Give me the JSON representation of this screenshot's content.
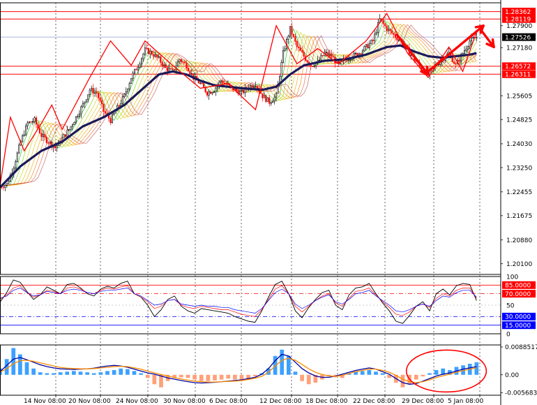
{
  "colors": {
    "background": "#ffffff",
    "bull": "#000000",
    "bear": "#ff0000",
    "level_line": "#ff0000",
    "current_price_line": "#aab4e6",
    "current_price_tag": "#000000",
    "slow_ma": "#1a1a5a",
    "zigzag": "#ff0000",
    "stoch_main": "#000000",
    "stoch_signal": "#ff0000",
    "stoch_third": "#0000ff",
    "macd_pos": "#3ca0ff",
    "macd_neg": "#ffa07a",
    "macd_line": "#0000a0",
    "macd_signal": "#ff8c00",
    "highlight_circle": "#ff0000"
  },
  "chart_data": [
    {
      "type": "candlestick",
      "panel": "main",
      "y_ticks": [
        "1.28362",
        "1.28119",
        "1.27900",
        "1.27526",
        "1.27180",
        "1.26572",
        "1.26311",
        "1.25605",
        "1.24825",
        "1.24030",
        "1.23250",
        "1.22455",
        "1.21675",
        "1.20880",
        "1.20100"
      ],
      "ylim": [
        1.1975,
        1.2865
      ],
      "grid": false,
      "x_ticks": [
        "14 Nov 08:00",
        "20 Nov 08:00",
        "24 Nov 08:00",
        "30 Nov 08:00",
        "6 Dec 08:00",
        "12 Dec 08:00",
        "18 Dec 08:00",
        "22 Dec 08:00",
        "29 Dec 08:00",
        "5 Jan 08:00"
      ],
      "horizontal_levels": [
        1.28362,
        1.28119,
        1.26572,
        1.26311
      ],
      "current_price": 1.27526,
      "price_tags": [
        {
          "value": 1.28362,
          "label": "1.28362",
          "style": "level"
        },
        {
          "value": 1.28119,
          "label": "1.28119",
          "style": "level"
        },
        {
          "value": 1.27526,
          "label": "1.27526",
          "style": "current"
        },
        {
          "value": 1.26572,
          "label": "1.26572",
          "style": "level"
        },
        {
          "value": 1.26311,
          "label": "1.26311",
          "style": "level"
        }
      ],
      "close_path": [
        [
          0,
          1.2265
        ],
        [
          4,
          1.227
        ],
        [
          8,
          1.233
        ],
        [
          12,
          1.241
        ],
        [
          16,
          1.247
        ],
        [
          20,
          1.248
        ],
        [
          24,
          1.243
        ],
        [
          28,
          1.241
        ],
        [
          32,
          1.239
        ],
        [
          36,
          1.242
        ],
        [
          40,
          1.245
        ],
        [
          44,
          1.249
        ],
        [
          48,
          1.253
        ],
        [
          52,
          1.258
        ],
        [
          56,
          1.257
        ],
        [
          60,
          1.251
        ],
        [
          64,
          1.248
        ],
        [
          68,
          1.252
        ],
        [
          72,
          1.256
        ],
        [
          76,
          1.262
        ],
        [
          80,
          1.266
        ],
        [
          84,
          1.271
        ],
        [
          88,
          1.27
        ],
        [
          92,
          1.268
        ],
        [
          96,
          1.265
        ],
        [
          100,
          1.264
        ],
        [
          104,
          1.268
        ],
        [
          108,
          1.266
        ],
        [
          112,
          1.262
        ],
        [
          116,
          1.26
        ],
        [
          120,
          1.257
        ],
        [
          124,
          1.258
        ],
        [
          128,
          1.261
        ],
        [
          132,
          1.2595
        ],
        [
          136,
          1.258
        ],
        [
          140,
          1.257
        ],
        [
          144,
          1.259
        ],
        [
          148,
          1.26
        ],
        [
          152,
          1.256
        ],
        [
          156,
          1.254
        ],
        [
          160,
          1.256
        ],
        [
          164,
          1.27
        ],
        [
          168,
          1.278
        ],
        [
          172,
          1.272
        ],
        [
          176,
          1.269
        ],
        [
          180,
          1.266
        ],
        [
          184,
          1.267
        ],
        [
          188,
          1.27
        ],
        [
          192,
          1.269
        ],
        [
          196,
          1.266
        ],
        [
          200,
          1.268
        ],
        [
          204,
          1.269
        ],
        [
          208,
          1.27
        ],
        [
          212,
          1.272
        ],
        [
          216,
          1.274
        ],
        [
          220,
          1.281
        ],
        [
          224,
          1.278
        ],
        [
          228,
          1.276
        ],
        [
          232,
          1.274
        ],
        [
          236,
          1.271
        ],
        [
          240,
          1.268
        ],
        [
          244,
          1.265
        ],
        [
          248,
          1.263
        ],
        [
          252,
          1.266
        ],
        [
          256,
          1.268
        ],
        [
          260,
          1.27
        ],
        [
          264,
          1.266
        ],
        [
          268,
          1.27
        ],
        [
          272,
          1.274
        ],
        [
          276,
          1.2752
        ]
      ],
      "slow_ma": [
        [
          0,
          1.226
        ],
        [
          12,
          1.233
        ],
        [
          24,
          1.238
        ],
        [
          36,
          1.241
        ],
        [
          48,
          1.246
        ],
        [
          60,
          1.249
        ],
        [
          72,
          1.253
        ],
        [
          84,
          1.259
        ],
        [
          92,
          1.263
        ],
        [
          100,
          1.264
        ],
        [
          108,
          1.263
        ],
        [
          116,
          1.261
        ],
        [
          124,
          1.2595
        ],
        [
          132,
          1.259
        ],
        [
          140,
          1.2585
        ],
        [
          152,
          1.258
        ],
        [
          160,
          1.259
        ],
        [
          168,
          1.263
        ],
        [
          176,
          1.266
        ],
        [
          188,
          1.2675
        ],
        [
          200,
          1.268
        ],
        [
          212,
          1.2695
        ],
        [
          224,
          1.272
        ],
        [
          232,
          1.2725
        ],
        [
          240,
          1.2705
        ],
        [
          248,
          1.269
        ],
        [
          256,
          1.2685
        ],
        [
          264,
          1.269
        ],
        [
          272,
          1.2695
        ],
        [
          276,
          1.27
        ]
      ],
      "zigzag": [
        [
          0,
          1.2265
        ],
        [
          6,
          1.249
        ],
        [
          14,
          1.238
        ],
        [
          24,
          1.247
        ],
        [
          30,
          1.253
        ],
        [
          36,
          1.245
        ],
        [
          52,
          1.262
        ],
        [
          64,
          1.274
        ],
        [
          76,
          1.266
        ],
        [
          84,
          1.274
        ],
        [
          100,
          1.266
        ],
        [
          116,
          1.2585
        ],
        [
          132,
          1.26
        ],
        [
          148,
          1.2515
        ],
        [
          160,
          1.279
        ],
        [
          172,
          1.2665
        ],
        [
          184,
          1.2715
        ],
        [
          196,
          1.2665
        ],
        [
          212,
          1.274
        ],
        [
          224,
          1.283
        ],
        [
          236,
          1.27
        ],
        [
          248,
          1.262
        ],
        [
          260,
          1.272
        ],
        [
          268,
          1.264
        ],
        [
          276,
          1.277
        ]
      ],
      "arrows": [
        {
          "from": [
            230,
            1.276
          ],
          "to": [
            248,
            1.263
          ]
        },
        {
          "from": [
            248,
            1.264
          ],
          "to": [
            280,
            1.279
          ]
        },
        {
          "from": [
            278,
            1.278
          ],
          "to": [
            286,
            1.272
          ]
        }
      ]
    },
    {
      "type": "line",
      "panel": "stochastic",
      "ylim": [
        0,
        100
      ],
      "levels": [
        85,
        70,
        30,
        15
      ],
      "y_ticks": [
        "100",
        "85.0000",
        "70.0000",
        "50",
        "30.0000",
        "15.0000",
        "0"
      ],
      "highlight_ticks": [
        "85.0000",
        "70.0000",
        "30.0000",
        "15.0000"
      ],
      "series": [
        {
          "values": [
            55,
            72,
            94,
            90,
            74,
            60,
            68,
            82,
            76,
            70,
            86,
            88,
            80,
            70,
            66,
            78,
            83,
            80,
            88,
            92,
            70,
            64,
            50,
            30,
            42,
            60,
            66,
            48,
            40,
            36,
            44,
            42,
            40,
            38,
            36,
            30,
            26,
            22,
            20,
            40,
            64,
            86,
            92,
            70,
            40,
            28,
            46,
            60,
            72,
            76,
            50,
            42,
            68,
            80,
            82,
            88,
            70,
            54,
            40,
            22,
            18,
            32,
            48,
            56,
            40,
            70,
            78,
            68,
            84,
            88,
            86,
            58
          ]
        },
        {
          "values": [
            60,
            68,
            80,
            84,
            72,
            64,
            68,
            76,
            74,
            70,
            80,
            82,
            78,
            72,
            70,
            76,
            80,
            78,
            82,
            84,
            70,
            64,
            56,
            44,
            48,
            58,
            60,
            50,
            46,
            44,
            48,
            46,
            44,
            42,
            42,
            38,
            34,
            32,
            30,
            42,
            60,
            78,
            84,
            70,
            48,
            38,
            48,
            58,
            66,
            70,
            54,
            48,
            62,
            74,
            76,
            80,
            68,
            56,
            46,
            34,
            32,
            38,
            48,
            52,
            46,
            62,
            70,
            66,
            76,
            80,
            80,
            62
          ]
        },
        {
          "values": [
            62,
            66,
            76,
            80,
            72,
            66,
            68,
            74,
            72,
            70,
            76,
            78,
            76,
            72,
            70,
            74,
            76,
            76,
            78,
            80,
            70,
            66,
            58,
            50,
            52,
            58,
            60,
            52,
            50,
            48,
            50,
            48,
            48,
            46,
            46,
            42,
            40,
            38,
            36,
            44,
            58,
            72,
            78,
            70,
            52,
            44,
            50,
            58,
            64,
            68,
            56,
            52,
            60,
            70,
            72,
            76,
            66,
            58,
            50,
            40,
            38,
            42,
            48,
            52,
            48,
            58,
            66,
            64,
            72,
            76,
            76,
            64
          ]
        }
      ]
    },
    {
      "type": "bar",
      "panel": "macd",
      "ylim": [
        -0.0065,
        0.0095
      ],
      "y_ticks": [
        "0.0088517",
        "0.00",
        "-0.005683"
      ],
      "values": [
        0.002,
        0.005,
        0.0085,
        0.0065,
        0.004,
        0.002,
        0.0008,
        0.0005,
        0.0005,
        0.0008,
        0.001,
        0.0012,
        0.001,
        0.0008,
        0.0005,
        0.0008,
        0.0012,
        0.0015,
        0.002,
        0.0018,
        0.0012,
        0.0005,
        -0.001,
        -0.003,
        -0.004,
        -0.002,
        -0.001,
        -0.0008,
        -0.001,
        -0.0015,
        -0.002,
        -0.002,
        -0.0018,
        -0.0015,
        -0.0012,
        -0.0015,
        -0.002,
        -0.0015,
        -0.0005,
        0.0005,
        0.002,
        0.006,
        0.008,
        0.006,
        0.001,
        -0.002,
        -0.003,
        -0.0025,
        -0.0015,
        -0.0005,
        -0.0008,
        -0.001,
        0.0005,
        0.001,
        0.0012,
        0.0015,
        0.001,
        0.0005,
        -0.001,
        -0.0025,
        -0.004,
        -0.003,
        -0.0015,
        -0.0005,
        0.0005,
        0.0015,
        0.002,
        0.0015,
        0.0025,
        0.003,
        0.0035,
        0.004
      ],
      "series": [
        {
          "values": [
            0.001,
            0.003,
            0.005,
            0.0055,
            0.0048,
            0.004,
            0.0032,
            0.0026,
            0.0022,
            0.0019,
            0.0018,
            0.0017,
            0.0018,
            0.0019,
            0.0021,
            0.0025,
            0.0028,
            0.003,
            0.0028,
            0.0024,
            0.0018,
            0.0012,
            0.0006,
            0.0002,
            -0.0004,
            -0.001,
            -0.0014,
            -0.0018,
            -0.0022,
            -0.0025,
            -0.0026,
            -0.0025,
            -0.0024,
            -0.0022,
            -0.002,
            -0.0018,
            -0.0016,
            -0.0012,
            -0.0008,
            0.0002,
            0.002,
            0.0045,
            0.0065,
            0.006,
            0.004,
            0.002,
            0.0006,
            -0.0004,
            -0.0008,
            -0.0008,
            -0.0004,
            0.0002,
            0.0008,
            0.0014,
            0.0018,
            0.0022,
            0.0018,
            0.001,
            0.0002,
            -0.0012,
            -0.0025,
            -0.003,
            -0.0028,
            -0.002,
            -0.0012,
            -0.0004,
            0.0002,
            0.0006,
            0.0012,
            0.0018,
            0.0022,
            0.0026
          ]
        },
        {
          "values": [
            0.0008,
            0.002,
            0.0035,
            0.0045,
            0.0046,
            0.0043,
            0.0038,
            0.0033,
            0.0028,
            0.0024,
            0.0021,
            0.002,
            0.0019,
            0.0019,
            0.002,
            0.0022,
            0.0024,
            0.0026,
            0.0027,
            0.0026,
            0.0022,
            0.0018,
            0.0012,
            0.0006,
            0.0001,
            -0.0004,
            -0.0009,
            -0.0013,
            -0.0017,
            -0.002,
            -0.0022,
            -0.0023,
            -0.0023,
            -0.0022,
            -0.0021,
            -0.002,
            -0.0018,
            -0.0015,
            -0.0011,
            -0.0005,
            0.0008,
            0.0028,
            0.0046,
            0.0053,
            0.0046,
            0.0033,
            0.0019,
            0.0008,
            0.0001,
            -0.0004,
            -0.0005,
            -0.0002,
            0.0004,
            0.001,
            0.0014,
            0.0018,
            0.0018,
            0.0014,
            0.0008,
            -0.0002,
            -0.0014,
            -0.0022,
            -0.0025,
            -0.0022,
            -0.0016,
            -0.0009,
            -0.0003,
            0.0002,
            0.0008,
            0.0013,
            0.0018,
            0.0022
          ]
        }
      ],
      "highlight": {
        "from_index": 62,
        "to_index": 71
      }
    }
  ]
}
